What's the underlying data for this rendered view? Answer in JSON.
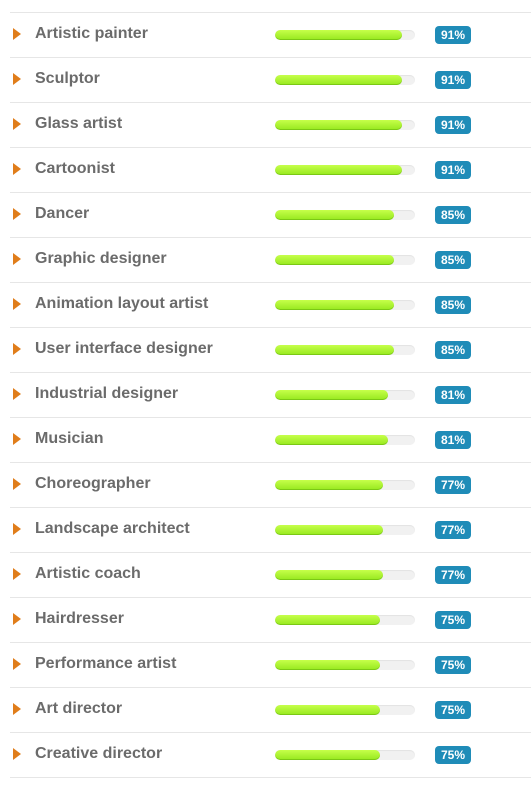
{
  "skills": [
    {
      "label": "Artistic painter",
      "percent_text": "91%",
      "value": 91
    },
    {
      "label": "Sculptor",
      "percent_text": "91%",
      "value": 91
    },
    {
      "label": "Glass artist",
      "percent_text": "91%",
      "value": 91
    },
    {
      "label": "Cartoonist",
      "percent_text": "91%",
      "value": 91
    },
    {
      "label": "Dancer",
      "percent_text": "85%",
      "value": 85
    },
    {
      "label": "Graphic designer",
      "percent_text": "85%",
      "value": 85
    },
    {
      "label": "Animation layout artist",
      "percent_text": "85%",
      "value": 85
    },
    {
      "label": "User interface designer",
      "percent_text": "85%",
      "value": 85
    },
    {
      "label": "Industrial designer",
      "percent_text": "81%",
      "value": 81
    },
    {
      "label": "Musician",
      "percent_text": "81%",
      "value": 81
    },
    {
      "label": "Choreographer",
      "percent_text": "77%",
      "value": 77
    },
    {
      "label": "Landscape architect",
      "percent_text": "77%",
      "value": 77
    },
    {
      "label": "Artistic coach",
      "percent_text": "77%",
      "value": 77
    },
    {
      "label": "Hairdresser",
      "percent_text": "75%",
      "value": 75
    },
    {
      "label": "Performance artist",
      "percent_text": "75%",
      "value": 75
    },
    {
      "label": "Art director",
      "percent_text": "75%",
      "value": 75
    },
    {
      "label": "Creative director",
      "percent_text": "75%",
      "value": 75
    }
  ],
  "colors": {
    "arrow": "#e07d1a",
    "label_text": "#6b6b6b",
    "bar_fill": "#a6f02c",
    "bar_track": "#f1f1f1",
    "badge_bg": "#1f8cb8",
    "badge_text": "#ffffff"
  },
  "icons": {
    "row_marker": "expand-arrow-icon"
  }
}
